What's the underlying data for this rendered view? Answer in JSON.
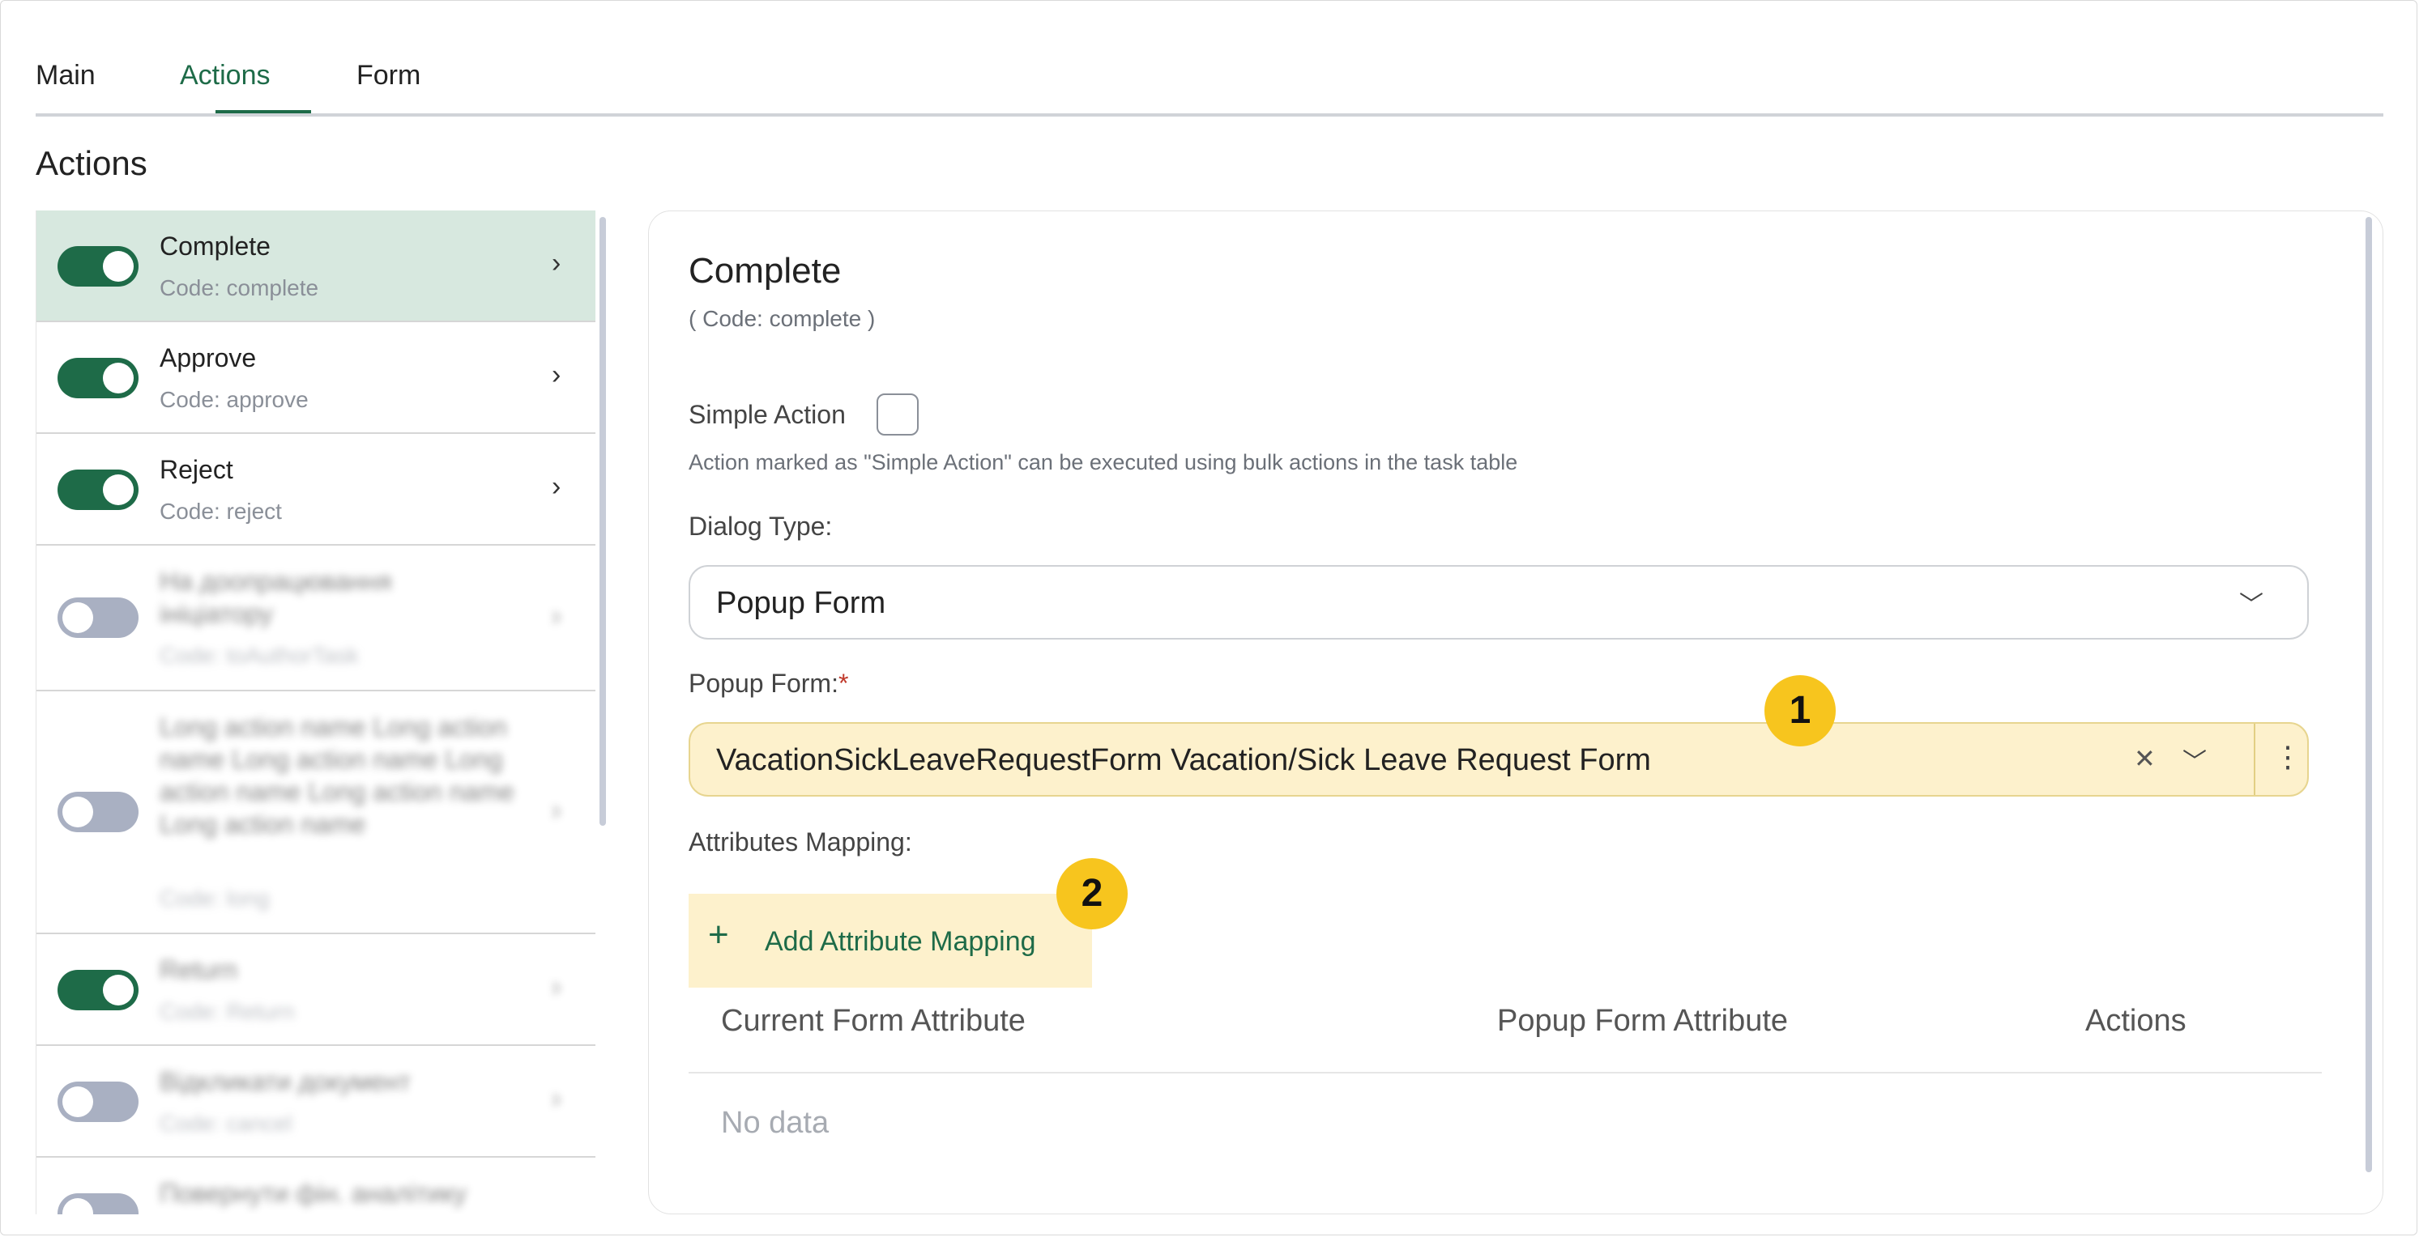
{
  "tabs": [
    "Main",
    "Actions",
    "Form"
  ],
  "section_title": "Actions",
  "actions_list": [
    {
      "title": "Complete",
      "code": "Code: complete",
      "enabled": true,
      "selected": true
    },
    {
      "title": "Approve",
      "code": "Code: approve",
      "enabled": true
    },
    {
      "title": "Reject",
      "code": "Code: reject",
      "enabled": true
    },
    {
      "title": "На доопрацювання ініціатору",
      "code": "Code: toAuthorTask",
      "enabled": false,
      "blurred": true
    },
    {
      "title": "Long action name Long action name Long action name Long action name Long action name Long action name",
      "code": "Code: long",
      "enabled": false,
      "blurred": true
    },
    {
      "title": "Return",
      "code": "Code: Return",
      "enabled": true,
      "blurred": true
    },
    {
      "title": "Відкликати документ",
      "code": "Code: cancel",
      "enabled": false,
      "blurred": true
    },
    {
      "title": "Повернути фін. аналітику",
      "code": "",
      "enabled": false,
      "blurred": true
    }
  ],
  "detail": {
    "title": "Complete",
    "code": "( Code: complete )",
    "simple_action_label": "Simple Action",
    "simple_action_hint": "Action marked as \"Simple Action\" can be executed using bulk actions in the task table",
    "dialog_type_label": "Dialog Type:",
    "dialog_type_value": "Popup Form",
    "popup_form_label": "Popup Form:",
    "popup_form_required": "*",
    "popup_form_value": "VacationSickLeaveRequestForm Vacation/Sick Leave Request Form",
    "attributes_mapping_label": "Attributes Mapping:",
    "add_mapping_label": "Add Attribute Mapping",
    "table_headers": [
      "Current Form Attribute",
      "Popup Form Attribute",
      "Actions"
    ],
    "no_data": "No data"
  },
  "badges": [
    "1",
    "2"
  ],
  "colors": {
    "accent": "#1e6b48",
    "highlight": "#fdf1cc",
    "badge": "#f7c51e",
    "selected_row": "#d7e8df"
  }
}
